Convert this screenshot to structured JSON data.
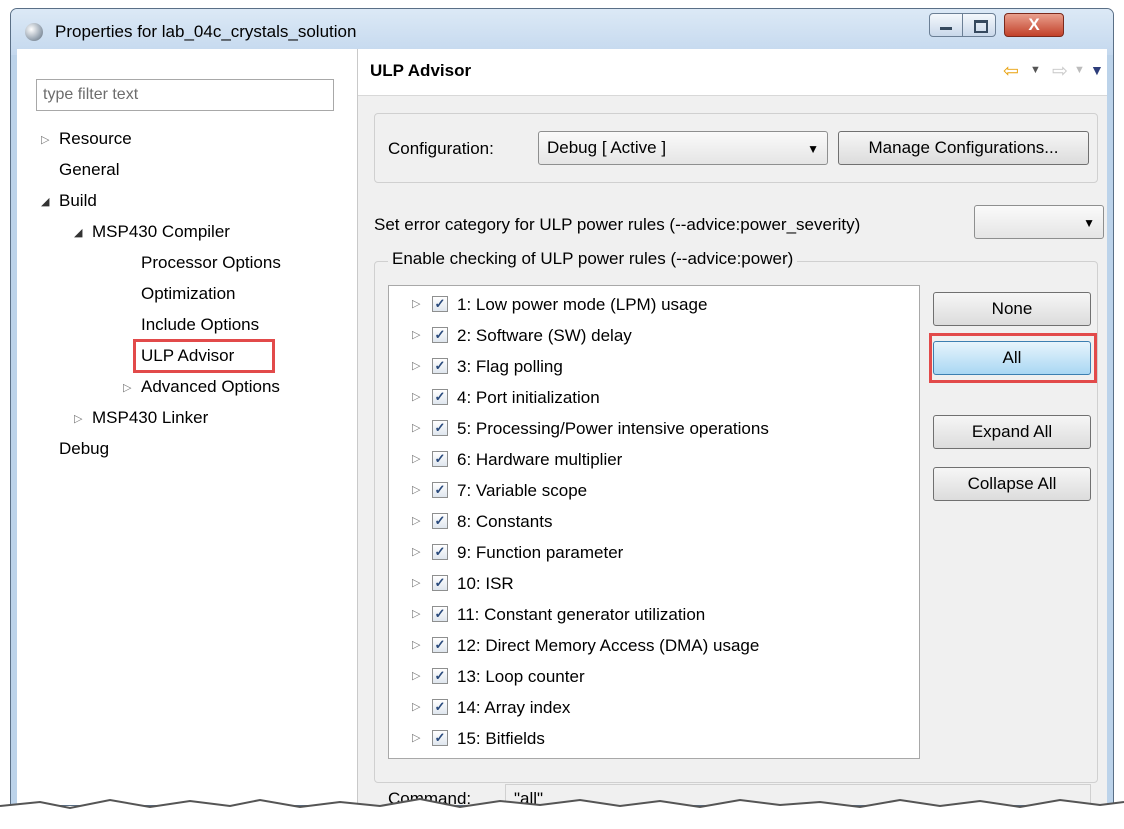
{
  "window": {
    "title": "Properties for lab_04c_crystals_solution",
    "close_glyph": "X"
  },
  "filter": {
    "placeholder": "type filter text"
  },
  "tree": {
    "resource": "Resource",
    "general": "General",
    "build": "Build",
    "compiler": "MSP430 Compiler",
    "processor_options": "Processor Options",
    "optimization": "Optimization",
    "include_options": "Include Options",
    "ulp_advisor": "ULP Advisor",
    "advanced_options": "Advanced Options",
    "linker": "MSP430 Linker",
    "debug": "Debug"
  },
  "page": {
    "title": "ULP Advisor"
  },
  "config": {
    "label": "Configuration:",
    "value": "Debug  [ Active ]",
    "manage_button": "Manage Configurations..."
  },
  "severity": {
    "label": "Set error category for ULP power rules (--advice:power_severity)",
    "value": ""
  },
  "rules_group": {
    "legend": "Enable checking of ULP power rules (--advice:power)",
    "rules": [
      {
        "label": "1: Low power mode (LPM) usage",
        "checked": true
      },
      {
        "label": "2: Software (SW) delay",
        "checked": true
      },
      {
        "label": "3: Flag polling",
        "checked": true
      },
      {
        "label": "4: Port initialization",
        "checked": true
      },
      {
        "label": "5: Processing/Power intensive operations",
        "checked": true
      },
      {
        "label": "6: Hardware multiplier",
        "checked": true
      },
      {
        "label": "7: Variable scope",
        "checked": true
      },
      {
        "label": "8: Constants",
        "checked": true
      },
      {
        "label": "9: Function parameter",
        "checked": true
      },
      {
        "label": "10: ISR",
        "checked": true
      },
      {
        "label": "11: Constant generator utilization",
        "checked": true
      },
      {
        "label": "12: Direct Memory Access (DMA) usage",
        "checked": true
      },
      {
        "label": "13: Loop counter",
        "checked": true
      },
      {
        "label": "14: Array index",
        "checked": true
      },
      {
        "label": "15: Bitfields",
        "checked": true
      }
    ],
    "buttons": {
      "none": "None",
      "all": "All",
      "expand_all": "Expand All",
      "collapse_all": "Collapse All"
    }
  },
  "command": {
    "label": "Command:",
    "value": "\"all\""
  },
  "colors": {
    "highlight": "#e24a4a",
    "active_button": "#a9d7f3"
  }
}
